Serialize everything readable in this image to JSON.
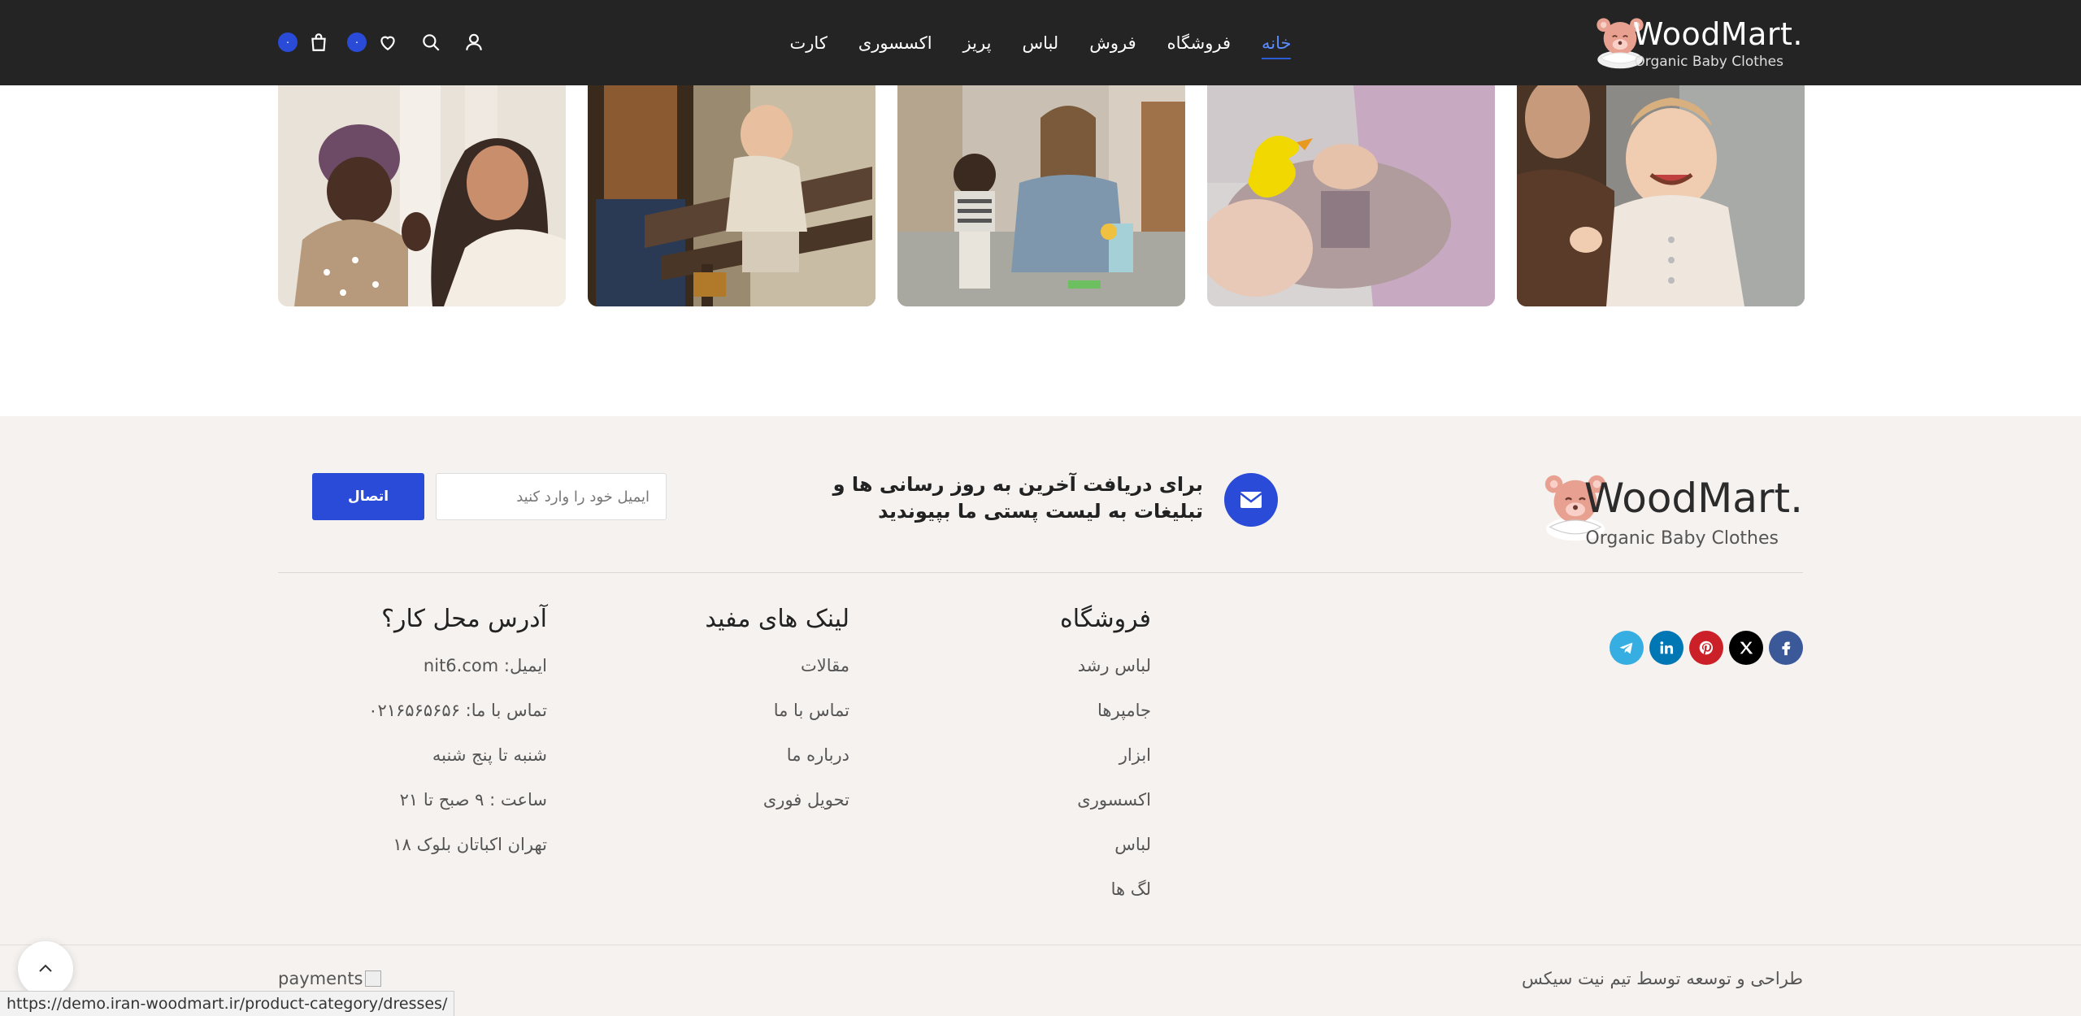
{
  "header": {
    "brand": "WoodMart.",
    "tagline": "Organic Baby Clothes",
    "nav": [
      "خانه",
      "فروشگاه",
      "فروش",
      "لباس",
      "پریز",
      "اکسسوری",
      "کارت"
    ],
    "wishlist_count": "۰",
    "cart_count": "۰"
  },
  "gallery": [
    {
      "name": "gallery-image-1"
    },
    {
      "name": "gallery-image-2"
    },
    {
      "name": "gallery-image-3"
    },
    {
      "name": "gallery-image-4"
    },
    {
      "name": "gallery-image-5"
    }
  ],
  "footer": {
    "brand": "WoodMart.",
    "tagline": "Organic Baby Clothes",
    "newsletter": {
      "text": "برای دریافت آخرین به روز رسانی ها و تبلیغات به لیست پستی ما بپیوندید",
      "placeholder": "ایمیل خود را وارد کنید",
      "button": "اتصال"
    },
    "shop": {
      "title": "فروشگاه",
      "links": [
        "لباس رشد",
        "جامپرها",
        "ابزار",
        "اکسسوری",
        "لباس",
        "لگ ها"
      ]
    },
    "useful": {
      "title": "لینک های مفید",
      "links": [
        "مقالات",
        "تماس با ما",
        "درباره ما",
        "تحویل فوری"
      ]
    },
    "address": {
      "title": "آدرس محل کار؟",
      "lines": [
        "ایمیل: nit6.com",
        "تماس با ما: ۰۲۱۶۵۶۵۶۵۶",
        "شنبه تا پنج شنبه",
        "ساعت : ۹ صبح تا ۲۱",
        "تهران اکباتان بلوک ۱۸"
      ]
    },
    "socials": [
      "facebook-icon",
      "x-icon",
      "pinterest-icon",
      "linkedin-icon",
      "telegram-icon"
    ],
    "copyright": "طراحی و توسعه توسط تیم نیت سیکس",
    "payments_alt": "payments"
  },
  "status_url": "https://demo.iran-woodmart.ir/product-category/dresses/",
  "colors": {
    "header_bg": "#242424",
    "accent": "#2a4bd7",
    "footer_bg": "#f5f2f0"
  }
}
